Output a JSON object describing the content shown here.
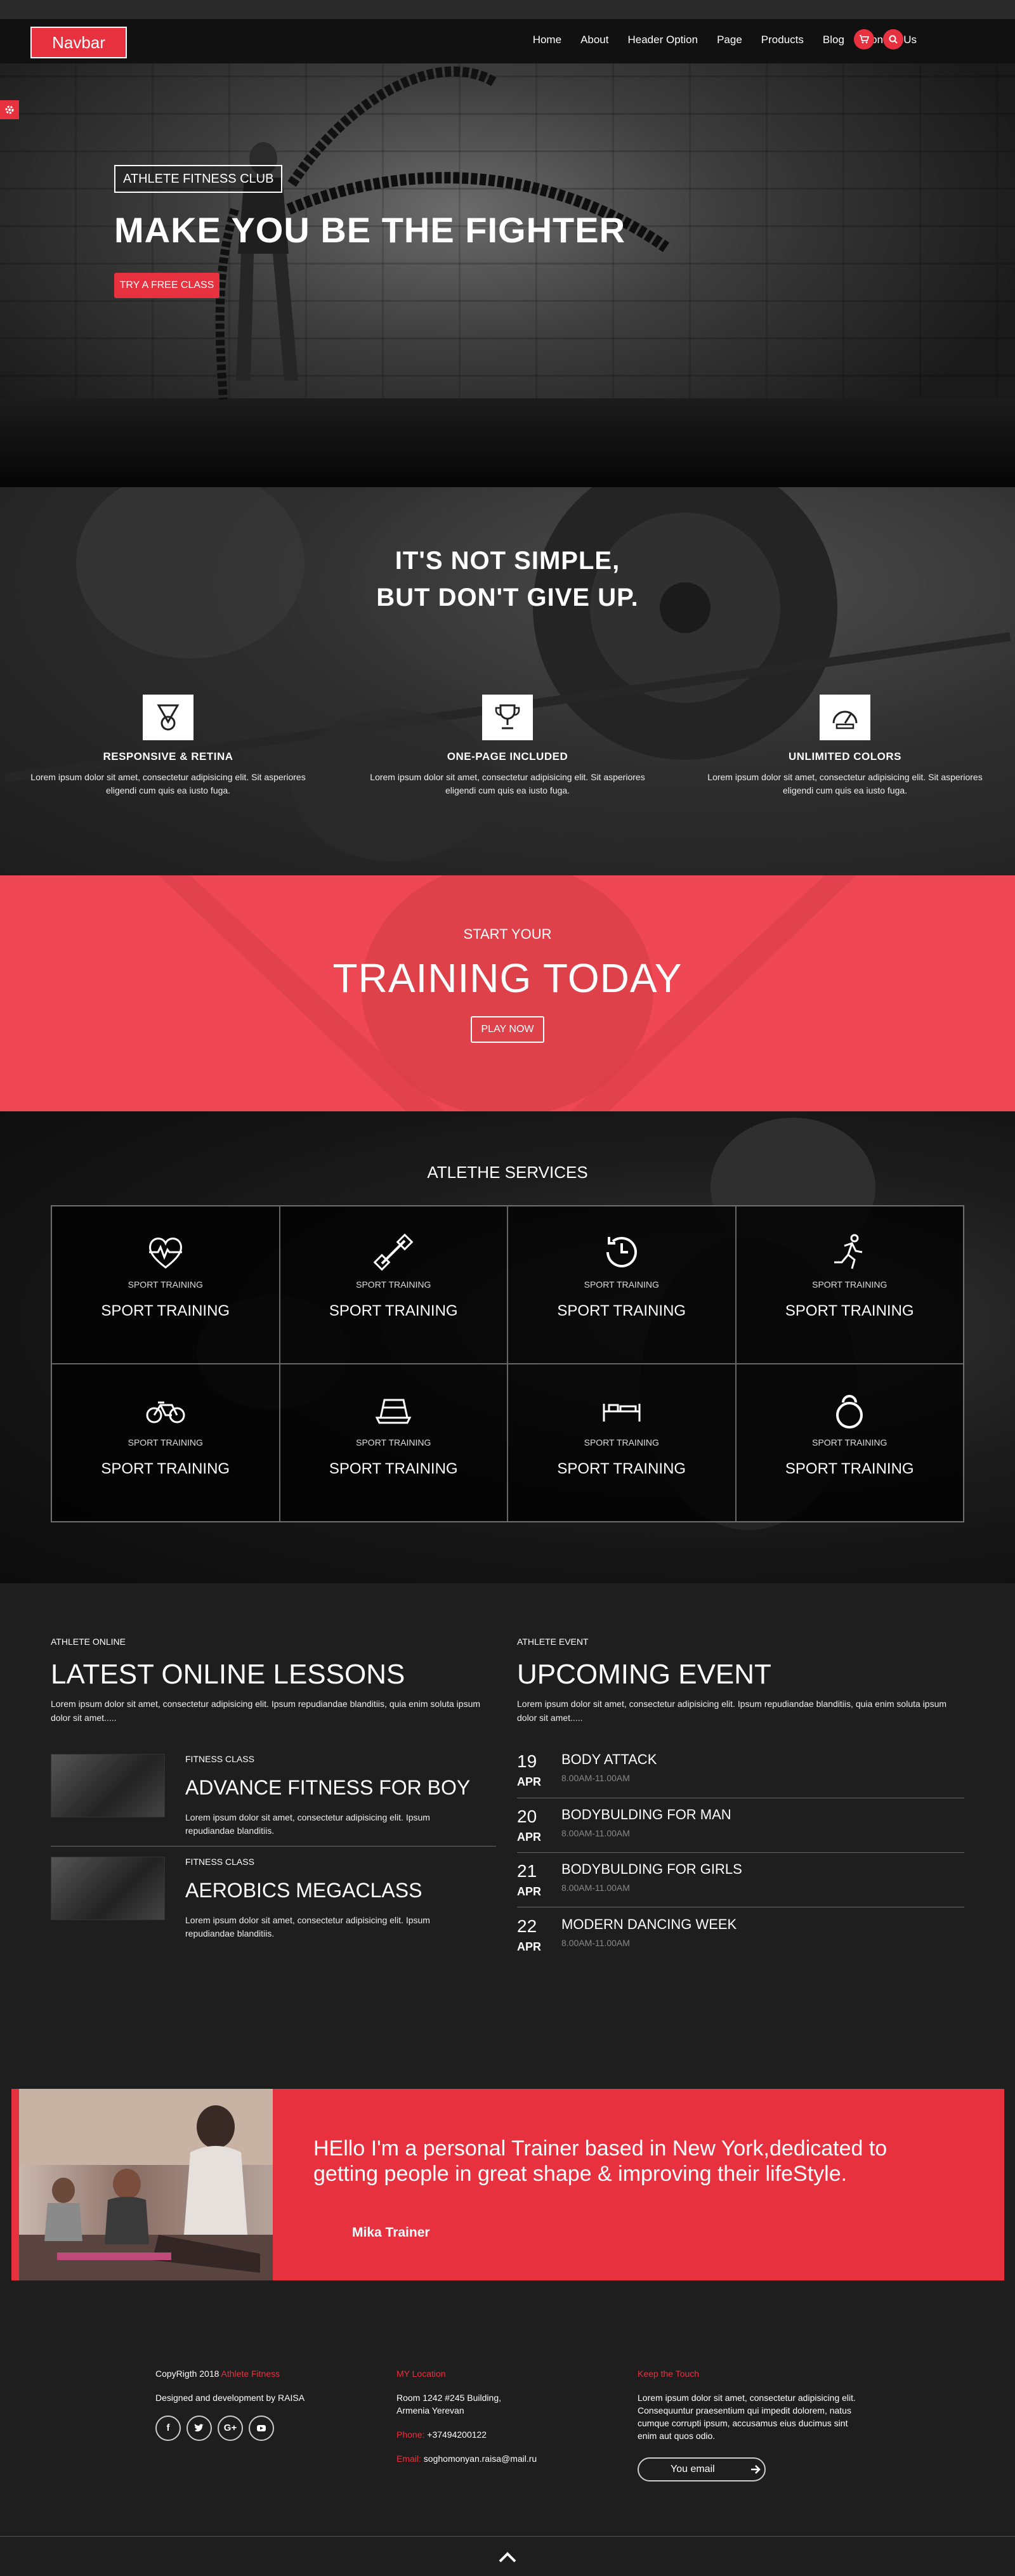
{
  "header": {
    "brand": "Navbar",
    "nav": [
      "Home",
      "About",
      "Header Option",
      "Page",
      "Products",
      "Blog",
      "Contact Us"
    ],
    "icons": [
      "cart-icon",
      "search-icon"
    ]
  },
  "hero": {
    "label": "ATHLETE FITNESS CLUB",
    "title": "MAKE YOU BE THE FIGHTER",
    "cta": "TRY A FREE CLASS"
  },
  "motivation": {
    "title_line1": "IT'S NOT SIMPLE,",
    "title_line2": "BUT DON'T GIVE UP.",
    "features": [
      {
        "icon": "medal-icon",
        "title": "RESPONSIVE & RETINA",
        "text": "Lorem ipsum dolor sit amet, consectetur adipisicing elit. Sit asperiores eligendi cum quis ea iusto fuga."
      },
      {
        "icon": "trophy-icon",
        "title": "ONE-PAGE INCLUDED",
        "text": "Lorem ipsum dolor sit amet, consectetur adipisicing elit. Sit asperiores eligendi cum quis ea iusto fuga."
      },
      {
        "icon": "speedometer-icon",
        "title": "UNLIMITED COLORS",
        "text": "Lorem ipsum dolor sit amet, consectetur adipisicing elit. Sit asperiores eligendi cum quis ea iusto fuga."
      }
    ]
  },
  "cta": {
    "small": "START YOUR",
    "big": "TRAINING TODAY",
    "button": "PLAY NOW"
  },
  "services": {
    "title": "ATLETHE SERVICES",
    "items": [
      {
        "icon": "heartbeat-icon",
        "small": "SPORT TRAINING",
        "big": "SPORT TRAINING"
      },
      {
        "icon": "dumbbell-icon",
        "small": "SPORT TRAINING",
        "big": "SPORT TRAINING"
      },
      {
        "icon": "clock-24h-icon",
        "small": "SPORT TRAINING",
        "big": "SPORT TRAINING"
      },
      {
        "icon": "runner-icon",
        "small": "SPORT TRAINING",
        "big": "SPORT TRAINING"
      },
      {
        "icon": "bicycle-icon",
        "small": "SPORT TRAINING",
        "big": "SPORT TRAINING"
      },
      {
        "icon": "treadmill-icon",
        "small": "SPORT TRAINING",
        "big": "SPORT TRAINING"
      },
      {
        "icon": "bench-icon",
        "small": "SPORT TRAINING",
        "big": "SPORT TRAINING"
      },
      {
        "icon": "kettlebell-icon",
        "small": "SPORT TRAINING",
        "big": "SPORT TRAINING"
      }
    ]
  },
  "lessons": {
    "label": "ATHLETE ONLINE",
    "title": "LATEST ONLINE LESSONS",
    "desc": "Lorem ipsum dolor sit amet, consectetur adipisicing elit. Ipsum repudiandae blanditiis, quia enim soluta ipsum dolor sit amet.....",
    "items": [
      {
        "small": "FITNESS CLASS",
        "title": "ADVANCE FITNESS FOR BOY",
        "desc": "Lorem ipsum dolor sit amet, consectetur adipisicing elit. Ipsum repudiandae blanditiis."
      },
      {
        "small": "FITNESS CLASS",
        "title": "AEROBICS MEGACLASS",
        "desc": "Lorem ipsum dolor sit amet, consectetur adipisicing elit. Ipsum repudiandae blanditiis."
      }
    ]
  },
  "events": {
    "label": "ATHLETE EVENT",
    "title": "UPCOMING EVENT",
    "desc": "Lorem ipsum dolor sit amet, consectetur adipisicing elit. Ipsum repudiandae blanditiis, quia enim soluta ipsum dolor sit amet.....",
    "items": [
      {
        "day": "19",
        "month": "APR",
        "title": "BODY ATTACK",
        "time": "8.00AM-11.00AM"
      },
      {
        "day": "20",
        "month": "APR",
        "title": "BODYBULDING FOR MAN",
        "time": "8.00AM-11.00AM"
      },
      {
        "day": "21",
        "month": "APR",
        "title": "BODYBULDING FOR GIRLS",
        "time": "8.00AM-11.00AM"
      },
      {
        "day": "22",
        "month": "APR",
        "title": "MODERN DANCING WEEK",
        "time": "8.00AM-11.00AM"
      }
    ]
  },
  "trainer": {
    "quote": "HEllo I'm a personal Trainer based in New York,dedicated to getting people in great shape & improving their lifeStyle.",
    "name": "Mika Trainer"
  },
  "footer": {
    "copyright": "CopyRigth 2018",
    "brand_name": "Athlete Fitness",
    "developer": "Designed and development by RAISA",
    "social": [
      "f",
      "t",
      "G+",
      "yt"
    ],
    "location_title": "MY Location",
    "address_line1": "Room 1242 #245 Building,",
    "address_line2": "Armenia Yerevan",
    "phone_label": "Phone:",
    "phone": "+37494200122",
    "email_label": "Email:",
    "email": "soghomonyan.raisa@mail.ru",
    "touch_title": "Keep the Touch",
    "touch_text": "Lorem ipsum dolor sit amet, consectetur adipisicing elit. Consequuntur praesentium qui impedit dolorem, natus cumque corrupti ipsum, accusamus eius ducimus sint enim aut quos odio.",
    "email_placeholder": "You email"
  },
  "colors": {
    "accent": "#e8313f",
    "cta_bg": "#ef4753",
    "dark": "#1e1e1e"
  }
}
